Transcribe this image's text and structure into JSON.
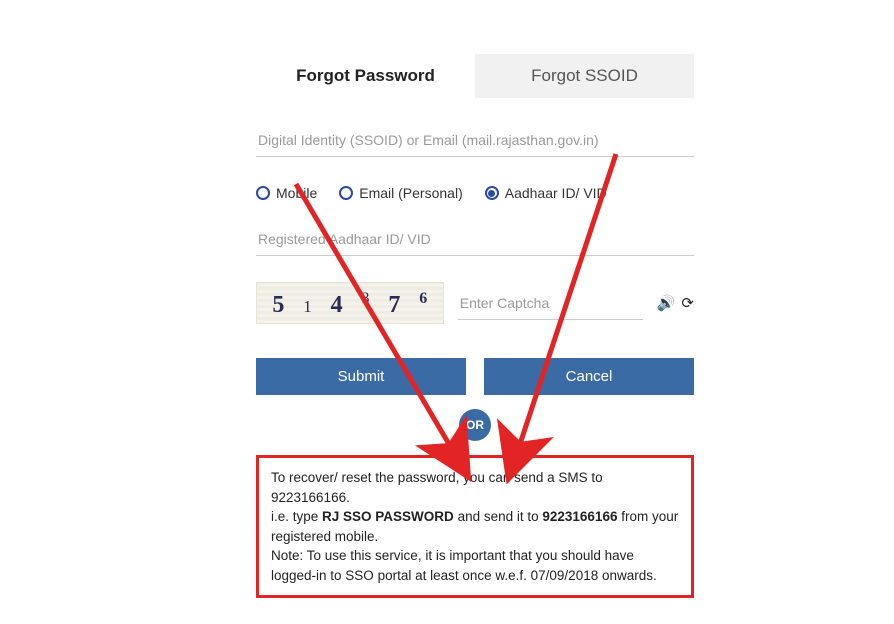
{
  "tabs": {
    "forgot_password": "Forgot Password",
    "forgot_ssoid": "Forgot SSOID"
  },
  "identity": {
    "placeholder": "Digital Identity (SSOID) or Email (mail.rajasthan.gov.in)"
  },
  "radios": {
    "mobile": "Mobile",
    "email": "Email (Personal)",
    "aadhaar": "Aadhaar ID/ VID",
    "selected": "aadhaar"
  },
  "registered": {
    "placeholder": "Registered Aadhaar ID/ VID"
  },
  "captcha": {
    "c1": "5",
    "c2": "1",
    "c3": "4",
    "c4": "3",
    "c5": "7",
    "c6": "6",
    "placeholder": "Enter Captcha"
  },
  "buttons": {
    "submit": "Submit",
    "cancel": "Cancel"
  },
  "or_label": "OR",
  "info": {
    "line1_a": "To recover/ reset the password, you can send a SMS to 9223166166.",
    "line2_a": "i.e. type ",
    "line2_b": "RJ SSO PASSWORD",
    "line2_c": " and send it to ",
    "line2_d": "9223166166",
    "line2_e": " from your registered mobile.",
    "line3": "Note: To use this service, it is important that you should have logged-in to SSO portal at least once w.e.f. 07/09/2018 onwards."
  }
}
